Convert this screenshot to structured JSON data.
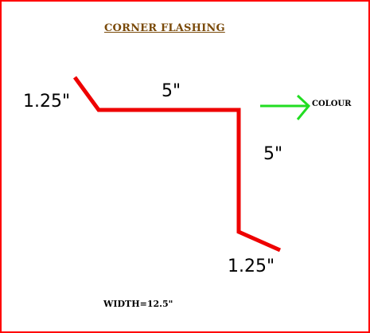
{
  "title": "CORNER  FLASHING",
  "dimensions": {
    "left_flange": "1.25\"",
    "top_segment": "5\"",
    "right_segment": "5\"",
    "bottom_flange": "1.25\""
  },
  "colour_label": "COLOUR",
  "width_label": "WIDTH=12.5\"",
  "colors": {
    "frame": "#ff0000",
    "flashing_line": "#ee0000",
    "arrow": "#22dd22",
    "title": "#7a4a0a",
    "text": "#000000"
  },
  "icons": {
    "colour_arrow": "right-arrow-icon"
  }
}
